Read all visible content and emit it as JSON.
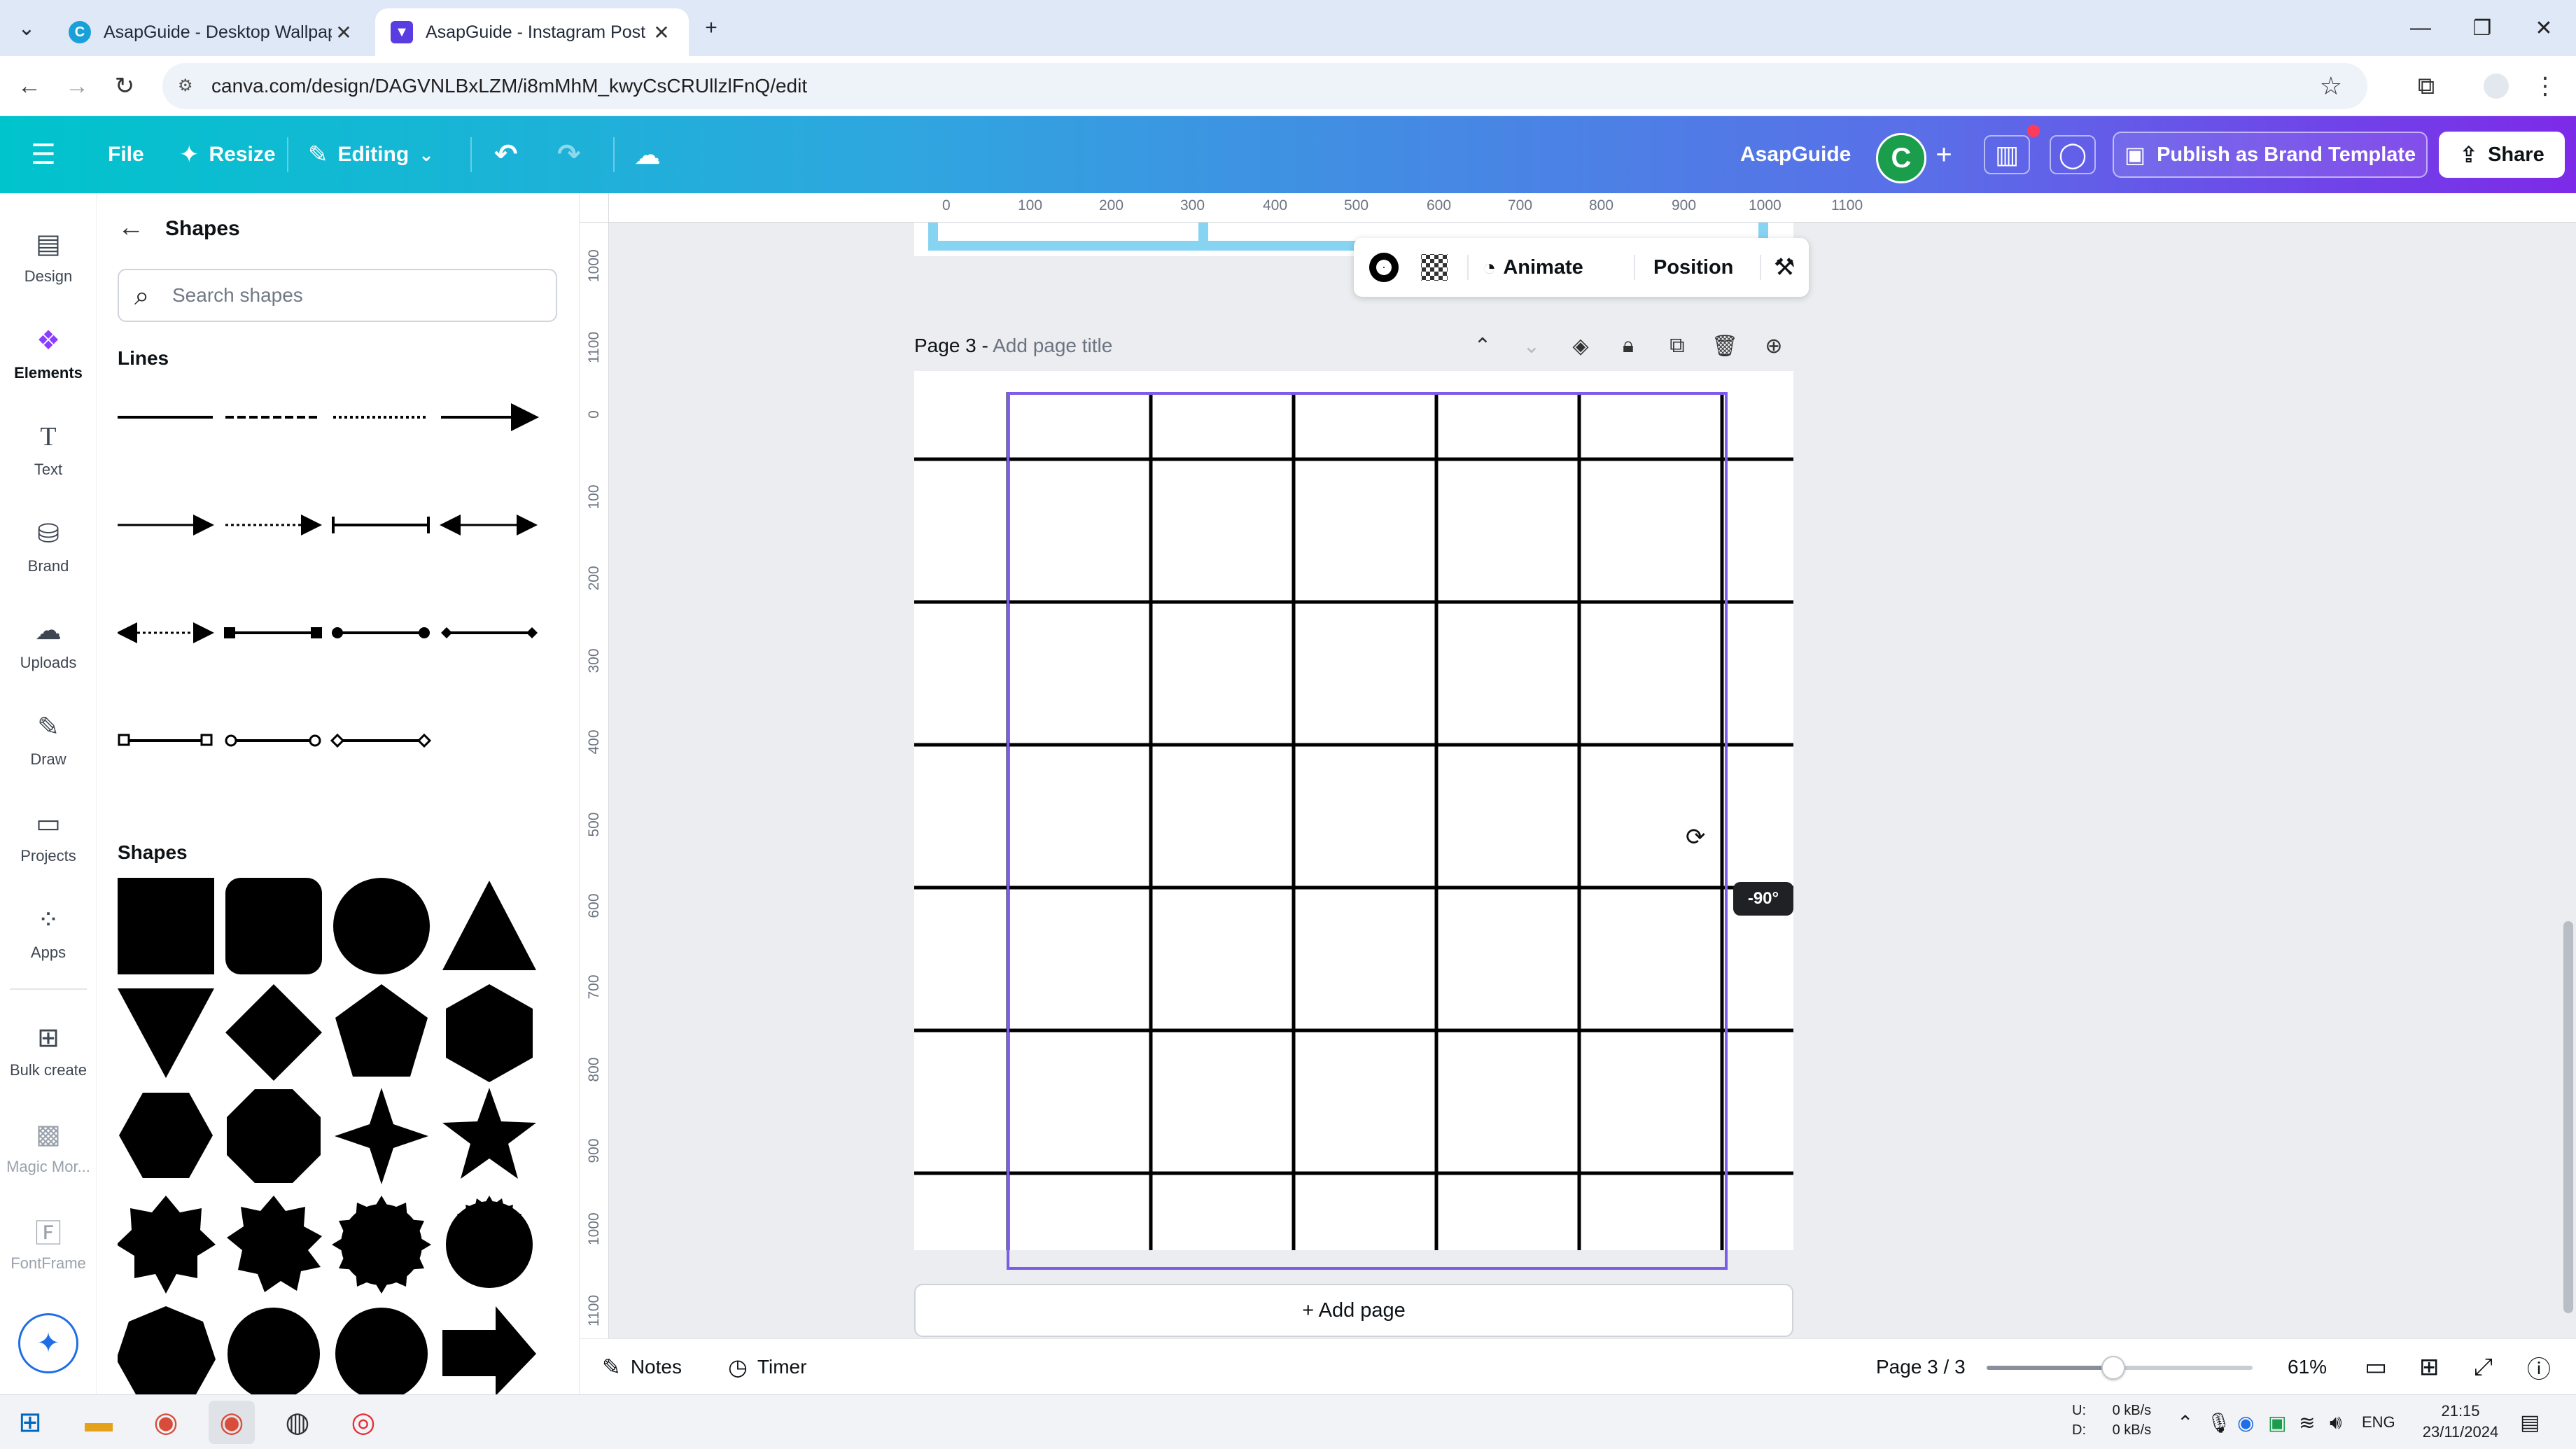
{
  "browser": {
    "tabs": [
      {
        "label": "AsapGuide - Desktop Wallpaper",
        "active": false
      },
      {
        "label": "AsapGuide - Instagram Post",
        "active": true
      }
    ],
    "new_tab_symbol": "+",
    "url": "canva.com/design/DAGVNLBxLZM/i8mMhM_kwyCsCRUllzlFnQ/edit"
  },
  "header": {
    "file_label": "File",
    "resize_label": "Resize",
    "editing_label": "Editing",
    "team_name": "AsapGuide",
    "avatar_letter": "C",
    "publish_label": "Publish as Brand Template",
    "share_label": "Share"
  },
  "rail": {
    "items": [
      {
        "label": "Design",
        "icon": "layout-icon"
      },
      {
        "label": "Elements",
        "icon": "elements-icon",
        "active": true
      },
      {
        "label": "Text",
        "icon": "text-icon"
      },
      {
        "label": "Brand",
        "icon": "brand-icon"
      },
      {
        "label": "Uploads",
        "icon": "cloud-upload-icon"
      },
      {
        "label": "Draw",
        "icon": "pen-icon"
      },
      {
        "label": "Projects",
        "icon": "folder-icon"
      },
      {
        "label": "Apps",
        "icon": "apps-icon"
      },
      {
        "label": "Bulk create",
        "icon": "bulk-create-icon"
      },
      {
        "label": "Magic Mor...",
        "icon": "magic-morph-icon"
      },
      {
        "label": "FontFrame",
        "icon": "fontframe-icon"
      }
    ]
  },
  "panel": {
    "title": "Shapes",
    "search_placeholder": "Search shapes",
    "lines_heading": "Lines",
    "shapes_heading": "Shapes"
  },
  "canvas": {
    "ruler_top": [
      "0",
      "100",
      "200",
      "300",
      "400",
      "500",
      "600",
      "700",
      "800",
      "900",
      "1000",
      "1100"
    ],
    "ruler_left": [
      "1000",
      "1100",
      "0",
      "100",
      "200",
      "300",
      "400",
      "500",
      "600",
      "700",
      "800",
      "900",
      "1000",
      "1100"
    ],
    "toolbar": {
      "animate_label": "Animate",
      "position_label": "Position"
    },
    "page_label": "Page 3 -",
    "page_title_placeholder": "Add page title",
    "rotation_badge": "-90°",
    "add_page_label": "+ Add page"
  },
  "status": {
    "notes_label": "Notes",
    "timer_label": "Timer",
    "page_indicator": "Page 3 / 3",
    "zoom_label": "61%",
    "zoom_fraction": 0.61
  },
  "taskbar": {
    "net_up": "U:",
    "net_down": "D:",
    "up_speed": "0 kB/s",
    "down_speed": "0 kB/s",
    "lang": "ENG",
    "time": "21:15",
    "date": "23/11/2024"
  },
  "colors": {
    "accent": "#8b3dff",
    "selection": "#7d5ce8",
    "prev_page_stroke": "#87d3f2"
  }
}
